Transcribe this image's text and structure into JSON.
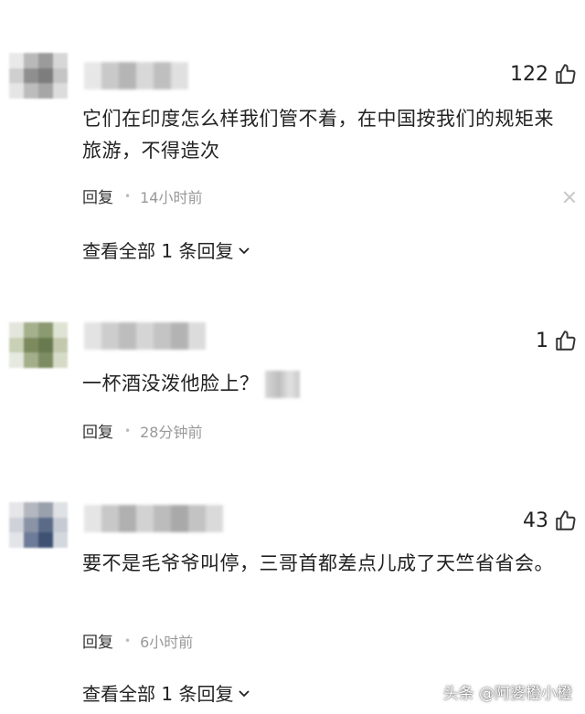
{
  "comments": [
    {
      "likes": "122",
      "text": "它们在印度怎么样我们管不着，在中国按我们的规矩来旅游，不得造次",
      "reply_label": "回复",
      "time": "14小时前",
      "view_replies": "查看全部 1 条回复"
    },
    {
      "likes": "1",
      "text": "一杯酒没泼他脸上？",
      "reply_label": "回复",
      "time": "28分钟前"
    },
    {
      "likes": "43",
      "text": "要不是毛爷爷叫停，三哥首都差点儿成了天竺省省会。",
      "reply_label": "回复",
      "time": "6小时前",
      "view_replies": "查看全部 1 条回复"
    }
  ],
  "watermark": "头条 @阿婆橙小橙"
}
